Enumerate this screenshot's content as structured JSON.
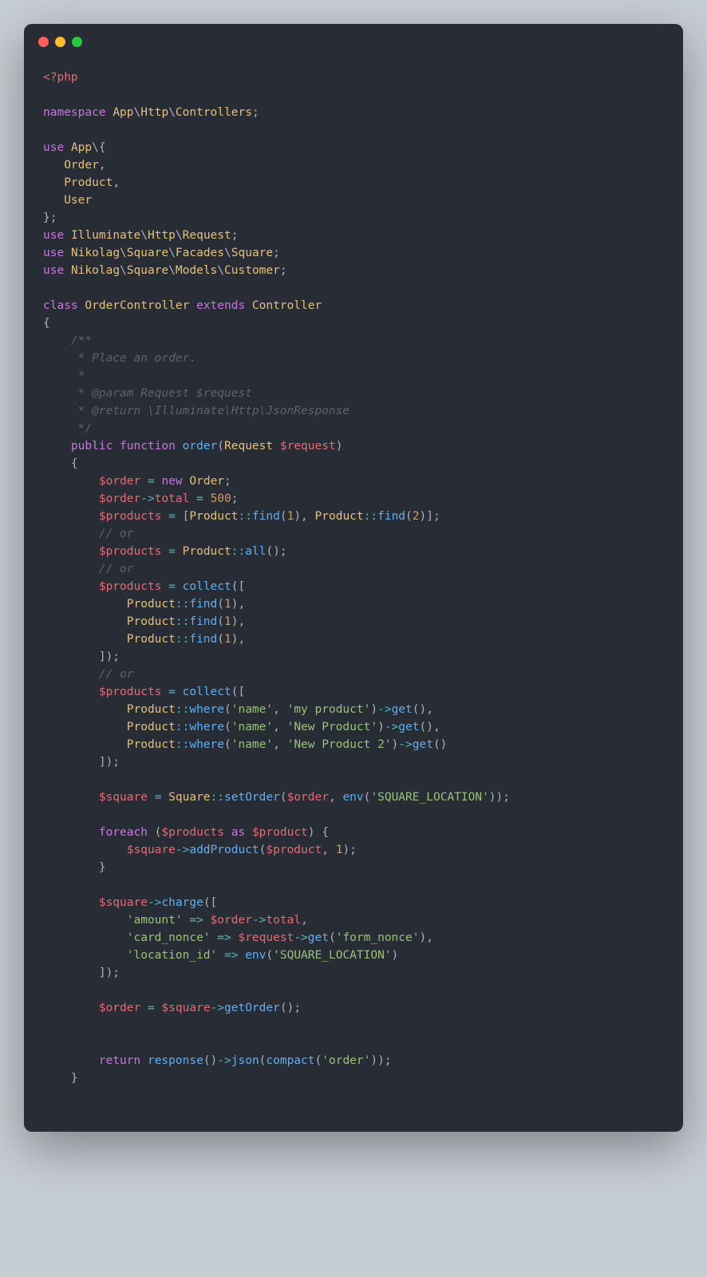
{
  "window": {
    "dots": [
      "close",
      "minimize",
      "zoom"
    ]
  },
  "code": {
    "lines": [
      {
        "raw": "<span class='tag'>&lt;?</span><span class='tag'>php</span>"
      },
      {
        "raw": ""
      },
      {
        "raw": "<span class='kw'>namespace</span> <span class='cls'>App</span>\\<span class='cls'>Http</span>\\<span class='cls'>Controllers</span>;"
      },
      {
        "raw": ""
      },
      {
        "raw": "<span class='kw'>use</span> <span class='cls'>App</span>\\{"
      },
      {
        "raw": "   <span class='cls'>Order</span>,"
      },
      {
        "raw": "   <span class='cls'>Product</span>,"
      },
      {
        "raw": "   <span class='cls'>User</span>"
      },
      {
        "raw": "};"
      },
      {
        "raw": "<span class='kw'>use</span> <span class='cls'>Illuminate</span>\\<span class='cls'>Http</span>\\<span class='cls'>Request</span>;"
      },
      {
        "raw": "<span class='kw'>use</span> <span class='cls'>Nikolag</span>\\<span class='cls'>Square</span>\\<span class='cls'>Facades</span>\\<span class='cls'>Square</span>;"
      },
      {
        "raw": "<span class='kw'>use</span> <span class='cls'>Nikolag</span>\\<span class='cls'>Square</span>\\<span class='cls'>Models</span>\\<span class='cls'>Customer</span>;"
      },
      {
        "raw": ""
      },
      {
        "raw": "<span class='kw'>class</span> <span class='cls'>OrderController</span> <span class='kw'>extends</span> <span class='cls'>Controller</span>"
      },
      {
        "raw": "{"
      },
      {
        "raw": "    <span class='cm'>/**</span>"
      },
      {
        "raw": "<span class='cm'>     * Place an order.</span>"
      },
      {
        "raw": "<span class='cm'>     *</span>"
      },
      {
        "raw": "<span class='cm'>     * @param Request $request</span>"
      },
      {
        "raw": "<span class='cm'>     * @return \\Illuminate\\Http\\JsonResponse</span>"
      },
      {
        "raw": "<span class='cm'>     */</span>"
      },
      {
        "raw": "    <span class='kw'>public</span> <span class='kw'>function</span> <span class='fn'>order</span>(<span class='cls'>Request</span> <span class='var'>$request</span>)"
      },
      {
        "raw": "    {"
      },
      {
        "raw": "        <span class='var'>$order</span> <span class='cyan'>=</span> <span class='kw'>new</span> <span class='cls'>Order</span>;"
      },
      {
        "raw": "        <span class='var'>$order</span><span class='cyan'>-&gt;</span><span class='red2'>total</span> <span class='cyan'>=</span> <span class='num'>500</span>;"
      },
      {
        "raw": "        <span class='var'>$products</span> <span class='cyan'>=</span> [<span class='cls'>Product</span><span class='cyan'>::</span><span class='fn'>find</span>(<span class='num'>1</span>), <span class='cls'>Product</span><span class='cyan'>::</span><span class='fn'>find</span>(<span class='num'>2</span>)];"
      },
      {
        "raw": "        <span class='cm'>// or</span>"
      },
      {
        "raw": "        <span class='var'>$products</span> <span class='cyan'>=</span> <span class='cls'>Product</span><span class='cyan'>::</span><span class='fn'>all</span>();"
      },
      {
        "raw": "        <span class='cm'>// or</span>"
      },
      {
        "raw": "        <span class='var'>$products</span> <span class='cyan'>=</span> <span class='fn'>collect</span>(["
      },
      {
        "raw": "            <span class='cls'>Product</span><span class='cyan'>::</span><span class='fn'>find</span>(<span class='num'>1</span>),"
      },
      {
        "raw": "            <span class='cls'>Product</span><span class='cyan'>::</span><span class='fn'>find</span>(<span class='num'>1</span>),"
      },
      {
        "raw": "            <span class='cls'>Product</span><span class='cyan'>::</span><span class='fn'>find</span>(<span class='num'>1</span>),"
      },
      {
        "raw": "        ]);"
      },
      {
        "raw": "        <span class='cm'>// or</span>"
      },
      {
        "raw": "        <span class='var'>$products</span> <span class='cyan'>=</span> <span class='fn'>collect</span>(["
      },
      {
        "raw": "            <span class='cls'>Product</span><span class='cyan'>::</span><span class='fn'>where</span>(<span class='str'>'name'</span>, <span class='str'>'my product'</span>)<span class='cyan'>-&gt;</span><span class='fn'>get</span>(),"
      },
      {
        "raw": "            <span class='cls'>Product</span><span class='cyan'>::</span><span class='fn'>where</span>(<span class='str'>'name'</span>, <span class='str'>'New Product'</span>)<span class='cyan'>-&gt;</span><span class='fn'>get</span>(),"
      },
      {
        "raw": "            <span class='cls'>Product</span><span class='cyan'>::</span><span class='fn'>where</span>(<span class='str'>'name'</span>, <span class='str'>'New Product 2'</span>)<span class='cyan'>-&gt;</span><span class='fn'>get</span>()"
      },
      {
        "raw": "        ]);"
      },
      {
        "raw": ""
      },
      {
        "raw": "        <span class='var'>$square</span> <span class='cyan'>=</span> <span class='cls'>Square</span><span class='cyan'>::</span><span class='fn'>setOrder</span>(<span class='var'>$order</span>, <span class='fn'>env</span>(<span class='str'>'SQUARE_LOCATION'</span>));"
      },
      {
        "raw": ""
      },
      {
        "raw": "        <span class='kw'>foreach</span> (<span class='var'>$products</span> <span class='kw'>as</span> <span class='var'>$product</span>) {"
      },
      {
        "raw": "            <span class='var'>$square</span><span class='cyan'>-&gt;</span><span class='fn'>addProduct</span>(<span class='var'>$product</span>, <span class='num'>1</span>);"
      },
      {
        "raw": "        }"
      },
      {
        "raw": ""
      },
      {
        "raw": "        <span class='var'>$square</span><span class='cyan'>-&gt;</span><span class='fn'>charge</span>(["
      },
      {
        "raw": "            <span class='str'>'amount'</span> <span class='cyan'>=&gt;</span> <span class='var'>$order</span><span class='cyan'>-&gt;</span><span class='red2'>total</span>,"
      },
      {
        "raw": "            <span class='str'>'card_nonce'</span> <span class='cyan'>=&gt;</span> <span class='var'>$request</span><span class='cyan'>-&gt;</span><span class='fn'>get</span>(<span class='str'>'form_nonce'</span>),"
      },
      {
        "raw": "            <span class='str'>'location_id'</span> <span class='cyan'>=&gt;</span> <span class='fn'>env</span>(<span class='str'>'SQUARE_LOCATION'</span>)"
      },
      {
        "raw": "        ]);"
      },
      {
        "raw": ""
      },
      {
        "raw": "        <span class='var'>$order</span> <span class='cyan'>=</span> <span class='var'>$square</span><span class='cyan'>-&gt;</span><span class='fn'>getOrder</span>();"
      },
      {
        "raw": ""
      },
      {
        "raw": ""
      },
      {
        "raw": "        <span class='kw'>return</span> <span class='fn'>response</span>()<span class='cyan'>-&gt;</span><span class='fn'>json</span>(<span class='fn'>compact</span>(<span class='str'>'order'</span>));"
      },
      {
        "raw": "    }"
      }
    ]
  }
}
